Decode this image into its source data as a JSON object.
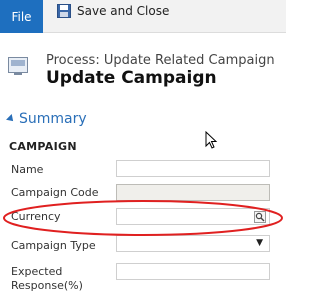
{
  "ribbon": {
    "file_label": "File",
    "save_close_label": "Save and Close"
  },
  "header": {
    "process_label": "Process: Update Related Campaign",
    "title": "Update Campaign"
  },
  "section": {
    "title": "Summary"
  },
  "group": {
    "title": "CAMPAIGN"
  },
  "fields": {
    "name": {
      "label": "Name",
      "value": ""
    },
    "campaign_code": {
      "label": "Campaign Code",
      "value": ""
    },
    "currency": {
      "label": "Currency",
      "value": ""
    },
    "campaign_type": {
      "label": "Campaign Type",
      "value": ""
    },
    "expected_response": {
      "label_line1": "Expected",
      "label_line2": "Response(%)",
      "value": ""
    }
  },
  "colors": {
    "file_tab": "#1e6fbf",
    "section_title": "#2a6fb8",
    "highlight": "#e02020"
  },
  "icons": {
    "save": "save-icon",
    "process": "process-icon",
    "lookup": "lookup-icon",
    "dropdown": "chevron-down-icon",
    "cursor": "mouse-cursor-icon"
  }
}
